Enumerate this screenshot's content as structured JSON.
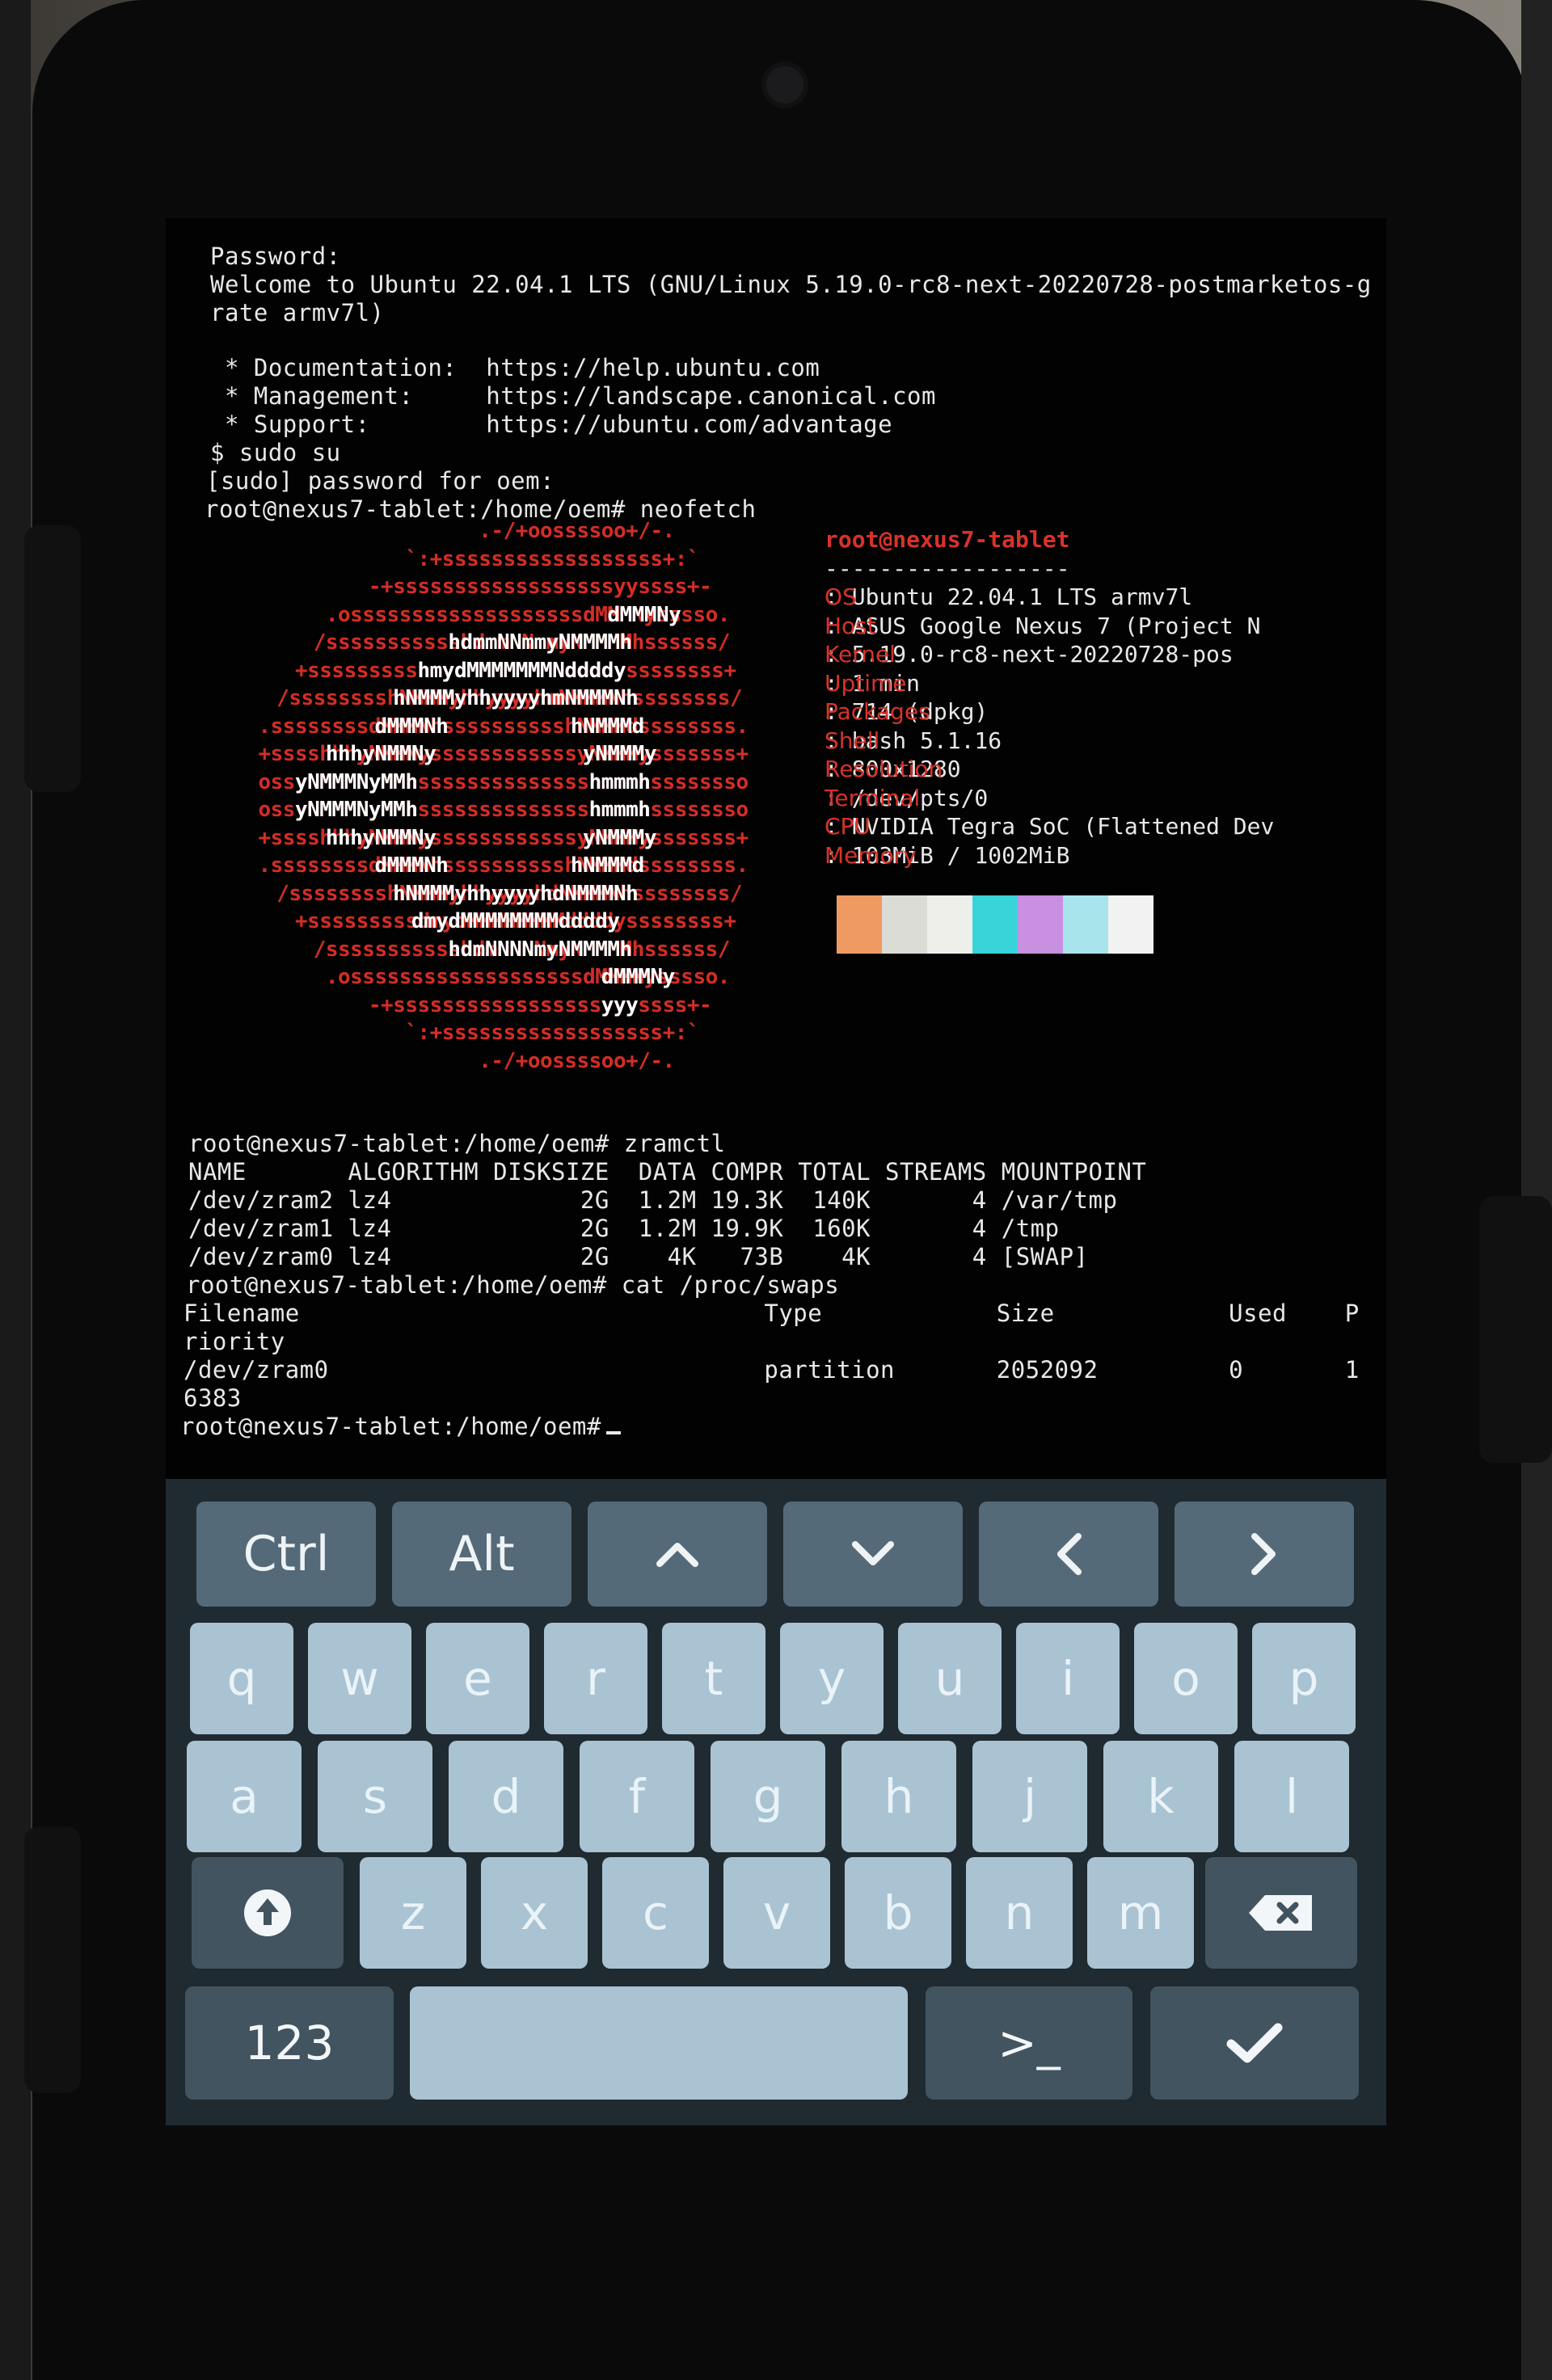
{
  "terminal": {
    "login": [
      "Password:",
      "Welcome to Ubuntu 22.04.1 LTS (GNU/Linux 5.19.0-rc8-next-20220728-postmarketos-g",
      "rate armv7l)",
      "",
      " * Documentation:  https://help.ubuntu.com",
      " * Management:     https://landscape.canonical.com",
      " * Support:        https://ubuntu.com/advantage",
      "$ sudo su",
      "[sudo] password for oem:",
      "root@nexus7-tablet:/home/oem# neofetch"
    ],
    "zramctl": [
      "root@nexus7-tablet:/home/oem# zramctl",
      "NAME       ALGORITHM DISKSIZE  DATA COMPR TOTAL STREAMS MOUNTPOINT",
      "/dev/zram2 lz4             2G  1.2M 19.3K  140K       4 /var/tmp",
      "/dev/zram1 lz4             2G  1.2M 19.9K  160K       4 /tmp",
      "/dev/zram0 lz4             2G    4K   73B    4K       4 [SWAP]",
      "root@nexus7-tablet:/home/oem# cat /proc/swaps"
    ],
    "swaps_header": "Filename                                Type            Size            Used    P",
    "swaps_header_wrap": "riority",
    "swaps_row": "/dev/zram0                              partition       2052092         0       1",
    "swaps_row_wrap": "6383",
    "prompt": "root@nexus7-tablet:/home/oem#"
  },
  "neofetch": {
    "logo_red": [
      "             .-/+oossssoo+/-.",
      "         `:+ssssssssssssssssss+:`",
      "       -+ssssssssssssssssssyyssss+-",
      "     .osssssssssssssssssssdMMMNysssso.",
      "    /ssssssssssshdmmNNmmyNMMMMhssssss/",
      "   +ssssssssshmydMMMMMMMNddddyssssssss+",
      "  /sssssssshNMMMyhhyyyyhmNMMMNhssssssss/",
      " .ssssssssdMMMNhsssssssssshNMMMdssssssss.",
      " +sssshhhyNMMNyssssssssssssyNMMMysssssss+",
      " ossyNMMMNyMMhsssssssssssssshmmmhssssssso",
      " ossyNMMMNyMMhsssssssssssssshmmmhssssssso",
      " +sssshhhyNMMNyssssssssssssyNMMMysssssss+",
      " .ssssssssdMMMNhsssssssssshNMMMdssssssss.",
      "  /sssssssshNMMMyhhyyyyhdNMMMNhssssssss/",
      "   +sssssssssdmydMMMMMMMMddddyssssssss+",
      "    /ssssssssssshdmNNNNmyNMMMMhssssss/",
      "     .osssssssssssssssssssdMMMNysssso.",
      "       -+sssssssssssssssssyyyssss+-",
      "         `:+ssssssssssssssssss+:`",
      "             .-/+oossssoo+/-."
    ],
    "logo_white": [
      "",
      "",
      "",
      "                             dMMMNy     ",
      "               hdmmNNmmyNMMMMh        ",
      "             hmydMMMMMMMNddddy         ",
      "            hNMMMyhhyyyyhmNMMMNh         ",
      "           dMMMNh          hNMMMd         ",
      "       hhhyNMMNy            yNMMMy        ",
      "    yNMMMNyMMh              hmmmh        ",
      "    yNMMMNyMMh              hmmmh        ",
      "       hhhyNMMNy            yNMMMy        ",
      "           dMMMNh          hNMMMd         ",
      "            hNMMMyhhyyyyhdNMMMNh         ",
      "             dmydMMMMMMMMddddy          ",
      "               hdmNNNNmyNMMMMh        ",
      "                            dMMMNy     ",
      "                           yyy       ",
      "",
      ""
    ],
    "title": "root@nexus7-tablet",
    "separator": "------------------",
    "fields": [
      {
        "key": "OS",
        "value": "Ubuntu 22.04.1 LTS armv7l"
      },
      {
        "key": "Host",
        "value": "ASUS Google Nexus 7 (Project N"
      },
      {
        "key": "Kernel",
        "value": "5.19.0-rc8-next-20220728-pos"
      },
      {
        "key": "Uptime",
        "value": "1 min"
      },
      {
        "key": "Packages",
        "value": "714 (dpkg)"
      },
      {
        "key": "Shell",
        "value": "bash 5.1.16"
      },
      {
        "key": "Resolution",
        "value": "800x1280"
      },
      {
        "key": "Terminal",
        "value": "/dev/pts/0"
      },
      {
        "key": "CPU",
        "value": "NVIDIA Tegra SoC (Flattened Dev"
      },
      {
        "key": "Memory",
        "value": "103MiB / 1002MiB"
      }
    ],
    "palette": [
      "#f09a63",
      "#dcdcd6",
      "#eeeeea",
      "#39d4da",
      "#c98fe0",
      "#a8e4ec",
      "#f2f2f2"
    ]
  },
  "keyboard": {
    "modifiers": [
      "Ctrl",
      "Alt"
    ],
    "row1": [
      "q",
      "w",
      "e",
      "r",
      "t",
      "y",
      "u",
      "i",
      "o",
      "p"
    ],
    "row2": [
      "a",
      "s",
      "d",
      "f",
      "g",
      "h",
      "j",
      "k",
      "l"
    ],
    "row3": [
      "z",
      "x",
      "c",
      "v",
      "b",
      "n",
      "m"
    ],
    "numbers_label": "123",
    "terminal_label": ">_"
  }
}
